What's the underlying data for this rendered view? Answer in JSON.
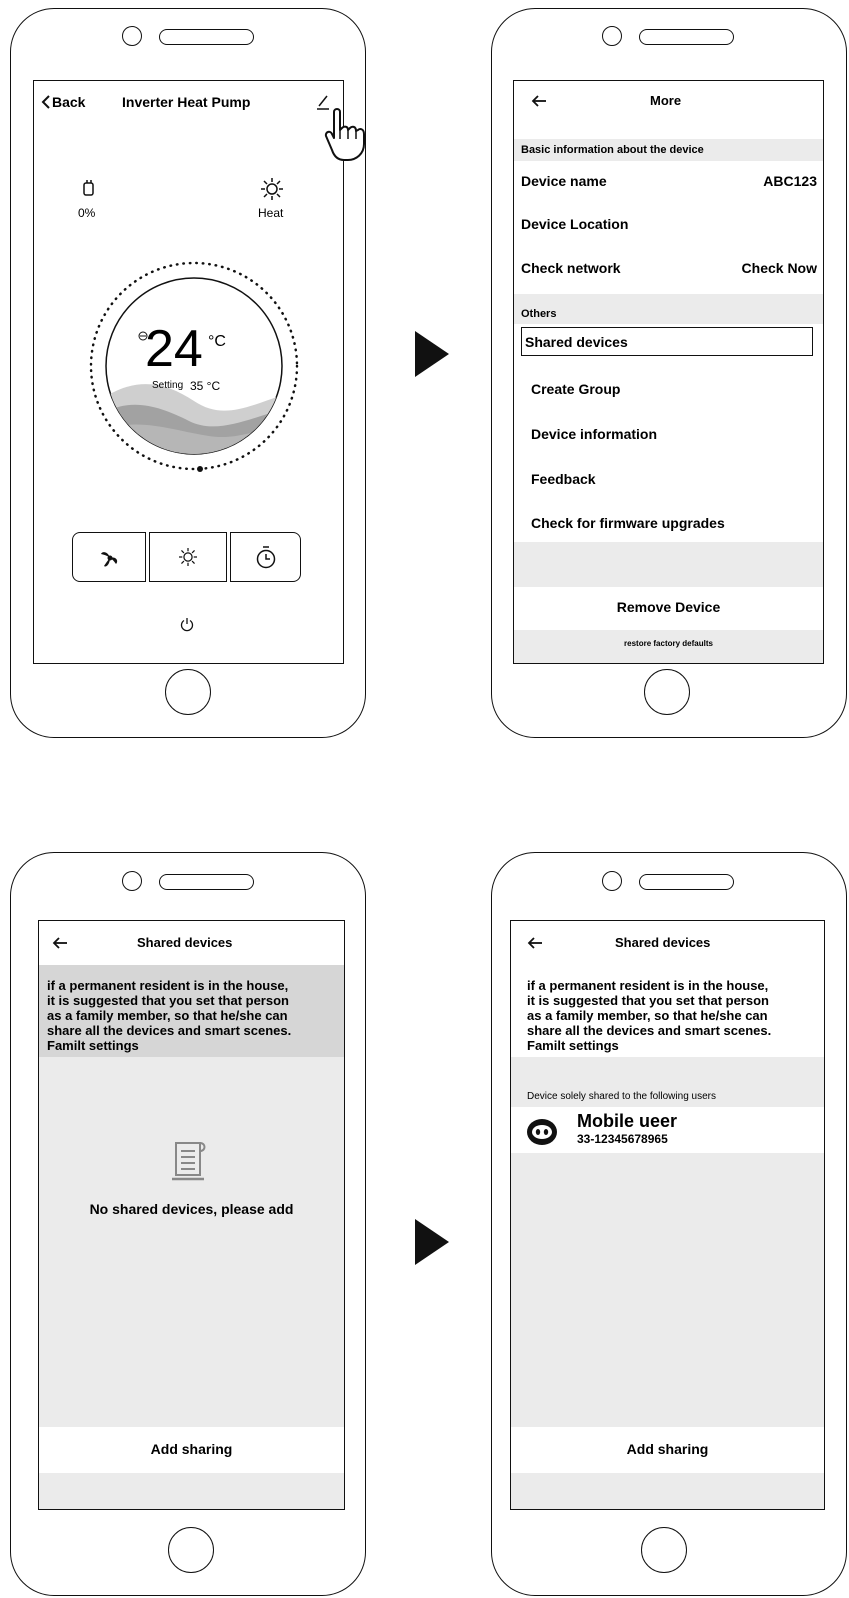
{
  "screen1": {
    "back_label": "Back",
    "title": "Inverter Heat Pump",
    "humidity_value": "0%",
    "mode_label": "Heat",
    "current_temp": "24",
    "temp_unit": "°C",
    "setting_label": "Setting",
    "setting_value": "35 °C",
    "icons": [
      "chevron-left-icon",
      "edit-pencil-icon",
      "tap-hand-icon",
      "water-tank-icon",
      "sun-icon",
      "fan-icon",
      "timer-icon",
      "power-icon"
    ]
  },
  "screen2": {
    "title": "More",
    "section_basic": "Basic information about the device",
    "device_name_label": "Device name",
    "device_name_value": "ABC123",
    "device_location_label": "Device Location",
    "check_network_label": "Check network",
    "check_network_value": "Check Now",
    "section_others": "Others",
    "shared_devices_label": "Shared devices",
    "create_group_label": "Create Group",
    "device_info_label": "Device information",
    "feedback_label": "Feedback",
    "firmware_label": "Check for firmware upgrades",
    "remove_device_label": "Remove Device",
    "restore_label": "restore factory defaults"
  },
  "screen3": {
    "title": "Shared devices",
    "notice_lines": [
      "if a permanent resident is in the house,",
      "it is suggested that you set that person",
      "as a family member, so that he/she can",
      "share all the devices and smart scenes.",
      "Familt settings"
    ],
    "empty_message": "No shared devices, please add",
    "add_sharing_label": "Add sharing"
  },
  "screen4": {
    "title": "Shared devices",
    "notice_lines": [
      "if a permanent resident is in the house,",
      "it is suggested that you set that person",
      "as a family member, so that he/she can",
      "share all the devices and smart scenes.",
      "Familt settings"
    ],
    "shared_header": "Device solely shared to the following users",
    "user_name": "Mobile ueer",
    "user_phone": "33-12345678965",
    "add_sharing_label": "Add sharing"
  },
  "colors": {
    "outline": "#111111",
    "section_gray": "#d6d6d6",
    "list_gray": "#ebebeb",
    "wave_dark": "#9a9a9a",
    "wave_light": "#cfcfcf"
  }
}
